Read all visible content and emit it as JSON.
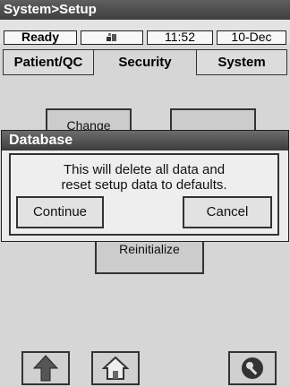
{
  "title": "System>Setup",
  "status": {
    "state": "Ready",
    "time": "11:52",
    "date": "10-Dec",
    "connection_icon": "connection-icon"
  },
  "tabs": [
    {
      "label": "Patient/QC",
      "active": false
    },
    {
      "label": "Security",
      "active": true
    },
    {
      "label": "System",
      "active": false
    }
  ],
  "panel": {
    "change_label": "Change",
    "reinitialize_label": "Reinitialize"
  },
  "dialog": {
    "title": "Database",
    "message_line1": "This will delete all data and",
    "message_line2": "reset  setup data to defaults.",
    "continue_label": "Continue",
    "cancel_label": "Cancel"
  },
  "bottom_bar": {
    "up_icon": "up-arrow-icon",
    "home_icon": "home-icon",
    "key_icon": "key-icon"
  },
  "colors": {
    "titlebar": "#4a4a4a",
    "screen_bg": "#d6d6d6",
    "dialog_bg": "#ebebeb"
  }
}
